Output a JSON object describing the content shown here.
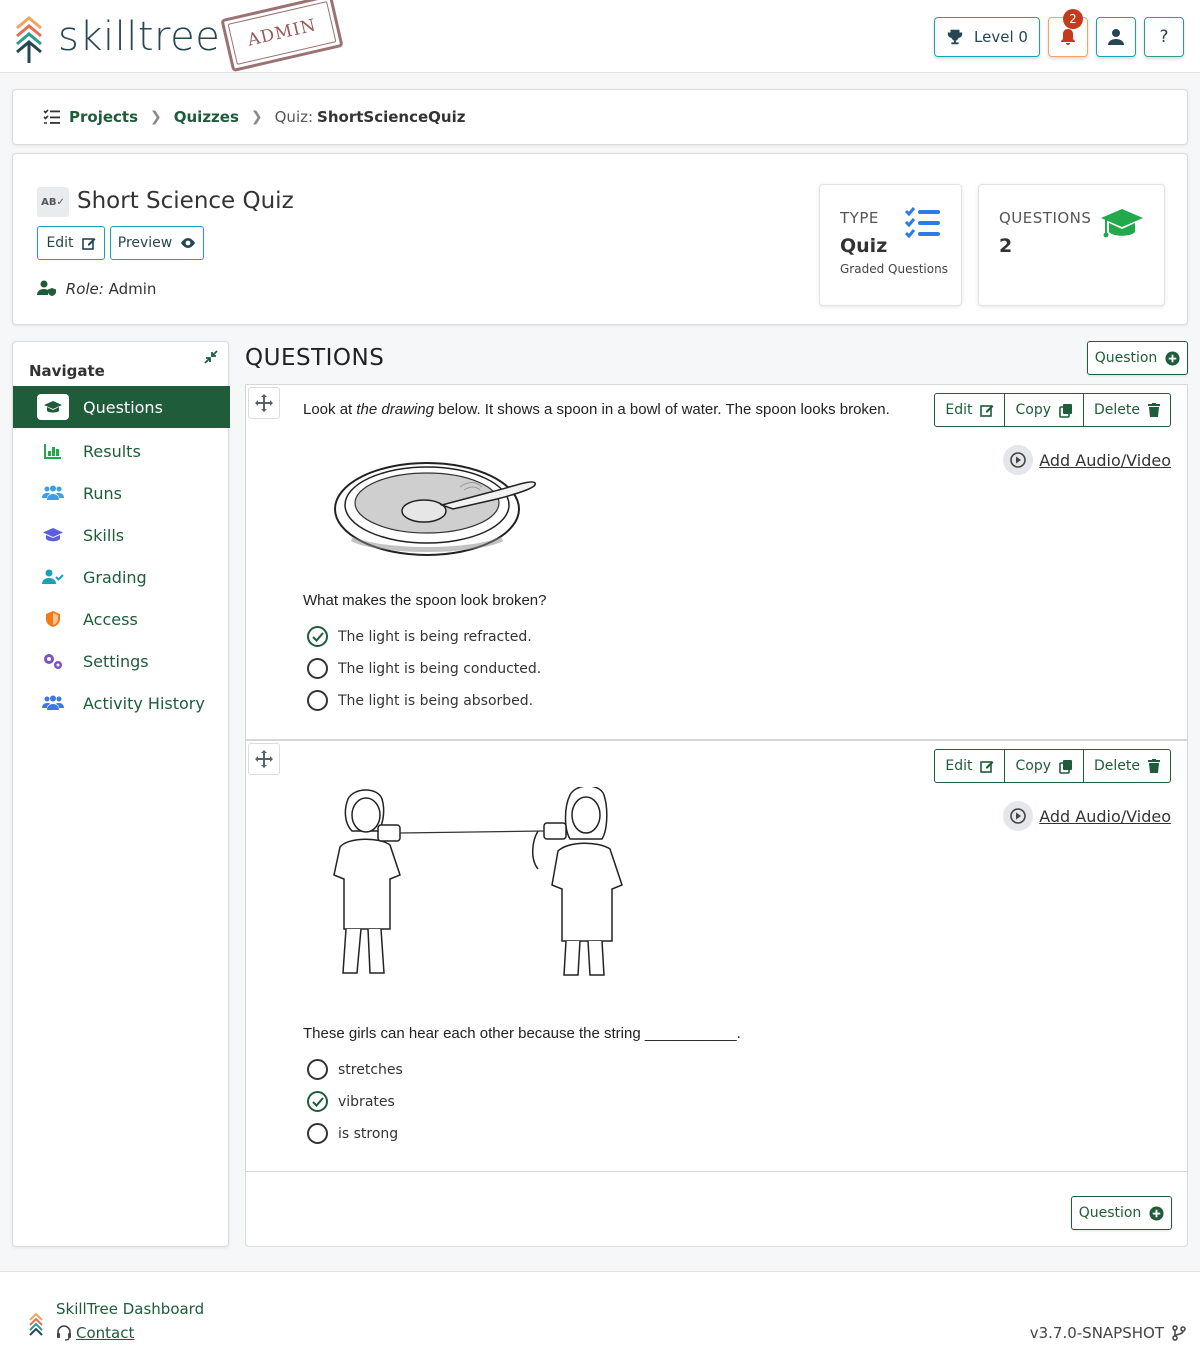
{
  "app": {
    "brand": "skilltree",
    "stamp": "ADMIN"
  },
  "topbar": {
    "level_label": "Level 0",
    "notification_count": "2",
    "help_label": "?"
  },
  "breadcrumb": {
    "projects": "Projects",
    "quizzes": "Quizzes",
    "current_prefix": "Quiz:",
    "current": "ShortScienceQuiz"
  },
  "quiz": {
    "icon_text": "AB",
    "title": "Short Science Quiz",
    "edit_label": "Edit",
    "preview_label": "Preview",
    "role_prefix": "Role:",
    "role": "Admin"
  },
  "stats": {
    "type": {
      "label": "TYPE",
      "value": "Quiz",
      "sub": "Graded Questions"
    },
    "questions": {
      "label": "QUESTIONS",
      "value": "2"
    }
  },
  "nav": {
    "title": "Navigate",
    "items": [
      {
        "label": "Questions",
        "icon": "graduation-cap-icon",
        "active": true
      },
      {
        "label": "Results",
        "icon": "chart-icon"
      },
      {
        "label": "Runs",
        "icon": "users-icon"
      },
      {
        "label": "Skills",
        "icon": "graduation-cap-icon"
      },
      {
        "label": "Grading",
        "icon": "user-check-icon"
      },
      {
        "label": "Access",
        "icon": "shield-icon"
      },
      {
        "label": "Settings",
        "icon": "gears-icon"
      },
      {
        "label": "Activity History",
        "icon": "users-icon"
      }
    ]
  },
  "main": {
    "heading": "QUESTIONS",
    "add_question_label": "Question",
    "btn_edit": "Edit",
    "btn_copy": "Copy",
    "btn_delete": "Delete",
    "add_av_label": "Add Audio/Video",
    "questions": [
      {
        "intro_before": "Look at ",
        "intro_em": "the drawing",
        "intro_after": " below. It shows a spoon in a bowl of water. The spoon looks broken.",
        "question": "What makes the spoon look broken?",
        "options": [
          {
            "text": "The light is being refracted.",
            "correct": true
          },
          {
            "text": "The light is being conducted.",
            "correct": false
          },
          {
            "text": "The light is being absorbed.",
            "correct": false
          }
        ]
      },
      {
        "question": "These girls can hear each other because the string ___________.",
        "options": [
          {
            "text": "stretches",
            "correct": false
          },
          {
            "text": "vibrates",
            "correct": true
          },
          {
            "text": "is strong",
            "correct": false
          }
        ]
      }
    ]
  },
  "footer": {
    "title": "SkillTree Dashboard",
    "contact": "Contact",
    "version": "v3.7.0-SNAPSHOT"
  },
  "colors": {
    "primary": "#1e5c3a",
    "info": "#17a2b8",
    "brand": "#264653"
  }
}
